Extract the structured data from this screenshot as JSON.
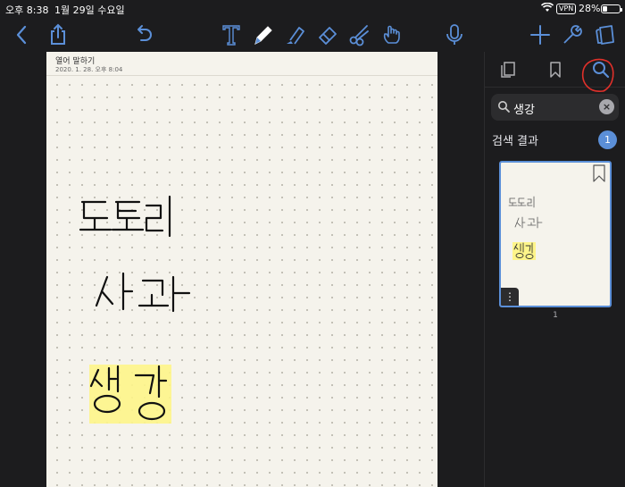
{
  "status": {
    "time": "오후 8:38",
    "date": "1월 29일 수요일",
    "vpn": "VPN",
    "battery": "28%",
    "battery_level": 0.28
  },
  "toolbar": {
    "icons": [
      "back-icon",
      "share-icon",
      "undo-icon",
      "text-tool-icon",
      "pen-tool-icon",
      "highlighter-tool-icon",
      "eraser-tool-icon",
      "lasso-tool-icon",
      "pointer-hand-icon",
      "microphone-icon",
      "add-icon",
      "settings-wrench-icon",
      "pages-icon"
    ],
    "accent": "#5b8fd8"
  },
  "note": {
    "title": "열어 말하기",
    "date": "2020. 1. 28. 오후 8:04",
    "words": [
      "도토리",
      "사과",
      "생강"
    ],
    "highlight_color": "#fef58a"
  },
  "sidebar": {
    "tabs": [
      "thumbnails-icon",
      "bookmark-icon",
      "search-icon"
    ],
    "active_tab": "search-icon",
    "search": {
      "value": "생강"
    },
    "results_label": "검색 결과",
    "results_count": "1",
    "thumbnail": {
      "page_number": "1",
      "more": "⋮",
      "words": [
        "도토리",
        "사과",
        "생강"
      ]
    }
  }
}
